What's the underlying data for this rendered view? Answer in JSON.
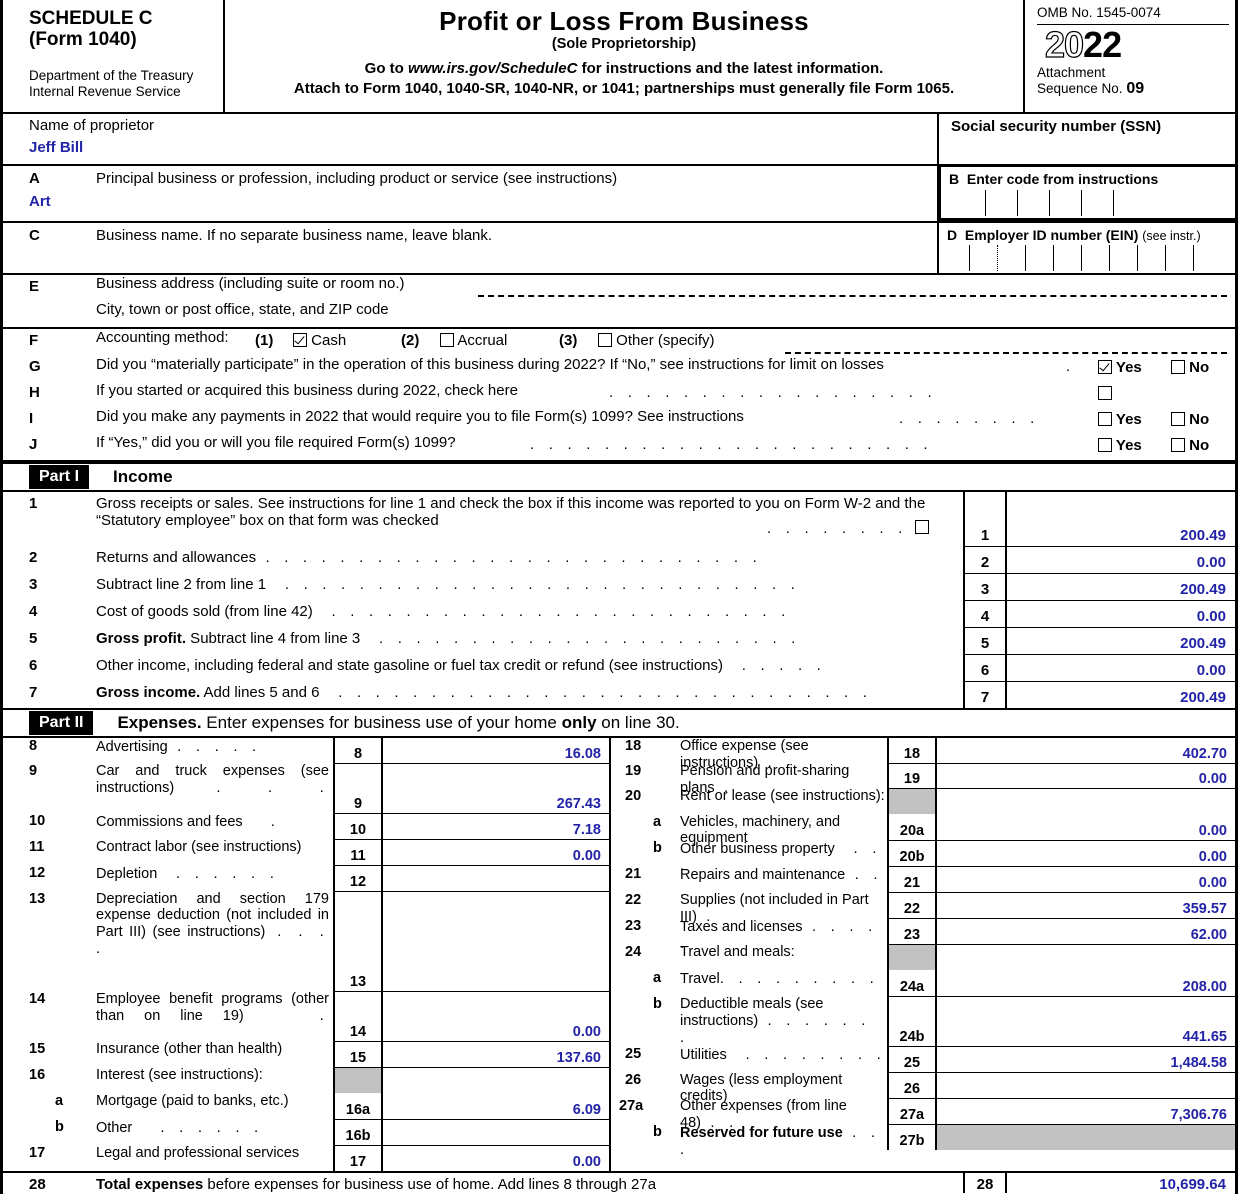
{
  "header": {
    "schedule": "SCHEDULE C",
    "form": "(Form 1040)",
    "dept_line1": "Department of the Treasury",
    "dept_line2": "Internal Revenue Service",
    "title": "Profit or Loss From Business",
    "subtitle": "(Sole Proprietorship)",
    "goto_prefix": "Go to ",
    "goto_url": "www.irs.gov/ScheduleC",
    "goto_suffix": " for instructions and the latest information.",
    "attach": "Attach to Form 1040, 1040-SR, 1040-NR, or 1041; partnerships must generally file Form 1065.",
    "omb": "OMB No. 1545-0074",
    "year_outline": "20",
    "year_solid": "22",
    "attachment_label": "Attachment",
    "sequence_label": "Sequence No. ",
    "sequence_no": "09"
  },
  "identity": {
    "name_label": "Name of proprietor",
    "name_value": "Jeff Bill",
    "ssn_label": "Social security number (SSN)",
    "ssn_value": "",
    "a_letter": "A",
    "a_label": "Principal business or profession, including product or service (see instructions)",
    "a_value": "Art",
    "b_letter": "B",
    "b_label": "Enter code from instructions",
    "b_value": "",
    "c_letter": "C",
    "c_label": "Business name. If no separate business name, leave blank.",
    "c_value": "",
    "d_letter": "D",
    "d_label": "Employer ID number (EIN)",
    "d_label_small": "(see instr.)",
    "d_value": ""
  },
  "questions": {
    "e_letter": "E",
    "e_label": "Business address (including suite or room no.)",
    "e_value": "",
    "e_city_label": "City, town or post office, state, and ZIP code",
    "e_city_value": "",
    "f_letter": "F",
    "f_label": "Accounting method:",
    "f_options": [
      {
        "num": "(1)",
        "label": "Cash",
        "checked": true
      },
      {
        "num": "(2)",
        "label": "Accrual",
        "checked": false
      },
      {
        "num": "(3)",
        "label": "Other (specify)",
        "checked": false
      }
    ],
    "g_letter": "G",
    "g_label": "Did you “materially participate” in the operation of this business during 2022? If “No,” see instructions for limit on losses",
    "g_yes": "Yes",
    "g_no": "No",
    "g_yes_checked": true,
    "g_no_checked": false,
    "h_letter": "H",
    "h_label": "If you started or acquired this business during 2022, check here",
    "h_checked": false,
    "i_letter": "I",
    "i_label": "Did you make any payments in 2022 that would require you to file Form(s) 1099? See instructions",
    "i_yes": "Yes",
    "i_no": "No",
    "i_yes_checked": false,
    "i_no_checked": false,
    "j_letter": "J",
    "j_label": "If “Yes,” did you or will you file required Form(s) 1099?",
    "j_yes": "Yes",
    "j_no": "No",
    "j_yes_checked": false,
    "j_no_checked": false
  },
  "part1": {
    "tag": "Part I",
    "title": "Income",
    "lines": [
      {
        "no": "1",
        "text_bold": "",
        "text": "Gross receipts or sales. See instructions for line 1 and check the box if this income was reported to you on Form W-2 and the “Statutory employee” box on that form was checked",
        "num": "1",
        "amount": "200.49",
        "has_checkbox": true,
        "checked": false
      },
      {
        "no": "2",
        "text_bold": "",
        "text": "Returns and allowances",
        "num": "2",
        "amount": "0.00"
      },
      {
        "no": "3",
        "text_bold": "",
        "text": "Subtract line 2 from line 1",
        "num": "3",
        "amount": "200.49"
      },
      {
        "no": "4",
        "text_bold": "",
        "text": "Cost of goods sold (from line 42)",
        "num": "4",
        "amount": "0.00"
      },
      {
        "no": "5",
        "text_bold": "Gross profit.",
        "text": " Subtract line 4 from line 3",
        "num": "5",
        "amount": "200.49"
      },
      {
        "no": "6",
        "text_bold": "",
        "text": "Other income, including federal and state gasoline or fuel tax credit or refund (see instructions)",
        "num": "6",
        "amount": "0.00"
      },
      {
        "no": "7",
        "text_bold": "Gross income.",
        "text": " Add lines 5 and 6",
        "num": "7",
        "amount": "200.49"
      }
    ]
  },
  "part2": {
    "tag": "Part II",
    "title_bold": "Expenses.",
    "title_rest": " Enter expenses for business use of your home ",
    "title_bold2": "only",
    "title_rest2": " on line 30.",
    "left": [
      {
        "no": "8",
        "text": "Advertising",
        "dots": ".  .   .   .   .",
        "num": "8",
        "amount": "16.08"
      },
      {
        "no": "9",
        "text": "Car and truck expenses (see instructions)",
        "dots": ".   .   .",
        "num": "9",
        "amount": "267.43"
      },
      {
        "no": "10",
        "text": "Commissions and fees",
        "dots": ".",
        "num": "10",
        "amount": "7.18"
      },
      {
        "no": "11",
        "text": "Contract labor (see instructions)",
        "dots": "",
        "num": "11",
        "amount": "0.00"
      },
      {
        "no": "12",
        "text": "Depletion",
        "dots": ".   .   .   .   .   .",
        "num": "12",
        "amount": ""
      },
      {
        "no": "13",
        "text": "Depreciation and section 179 expense deduction (not included in Part III) (see instructions)",
        "dots": ".   .   .   .",
        "num": "13",
        "amount": ""
      },
      {
        "no": "14",
        "text": "Employee benefit programs (other than on line 19)",
        "dots": ".",
        "num": "14",
        "amount": "0.00"
      },
      {
        "no": "15",
        "text": "Insurance (other than health)",
        "dots": "",
        "num": "15",
        "amount": "137.60"
      },
      {
        "no": "16",
        "text": "Interest (see instructions):",
        "dots": "",
        "num": "",
        "amount": "",
        "shaded": true
      },
      {
        "no": "a",
        "text": "Mortgage (paid to banks, etc.)",
        "dots": "",
        "num": "16a",
        "amount": "6.09"
      },
      {
        "no": "b",
        "text": "Other",
        "dots": ".   .   .   .   .   .",
        "num": "16b",
        "amount": ""
      },
      {
        "no": "17",
        "text": "Legal and professional services",
        "dots": "",
        "num": "17",
        "amount": "0.00"
      }
    ],
    "right": [
      {
        "no": "18",
        "text": "Office expense (see instructions)",
        "dots": ".",
        "num": "18",
        "amount": "402.70"
      },
      {
        "no": "19",
        "text": "Pension and profit-sharing plans",
        "dots": ".",
        "num": "19",
        "amount": "0.00"
      },
      {
        "no": "20",
        "text": "Rent or lease (see instructions):",
        "dots": "",
        "num": "",
        "amount": "",
        "shaded": true
      },
      {
        "no": "a",
        "text": "Vehicles, machinery, and equipment",
        "dots": "",
        "num": "20a",
        "amount": "0.00"
      },
      {
        "no": "b",
        "text": "Other business property",
        "dots": ".   .   .",
        "num": "20b",
        "amount": "0.00"
      },
      {
        "no": "21",
        "text": "Repairs and maintenance",
        "dots": ".   .   .",
        "num": "21",
        "amount": "0.00"
      },
      {
        "no": "22",
        "text": "Supplies (not included in Part III)",
        "dots": ".",
        "num": "22",
        "amount": "359.57"
      },
      {
        "no": "23",
        "text": "Taxes and licenses",
        "dots": ".   .   .   .   .",
        "num": "23",
        "amount": "62.00"
      },
      {
        "no": "24",
        "text": "Travel and meals:",
        "dots": "",
        "num": "",
        "amount": "",
        "shaded": true
      },
      {
        "no": "a",
        "text": "Travel",
        "dots": ".   .   .   .   .   .   .   .   .",
        "num": "24a",
        "amount": "208.00"
      },
      {
        "no": "b",
        "text": "Deductible meals (see instructions)",
        "dots": ".   .   .   .   .   .   .",
        "num": "24b",
        "amount": "441.65"
      },
      {
        "no": "25",
        "text": "Utilities",
        "dots": ".   .   .   .   .   .   .   .",
        "num": "25",
        "amount": "1,484.58"
      },
      {
        "no": "26",
        "text": "Wages (less employment credits)",
        "dots": "",
        "num": "26",
        "amount": ""
      },
      {
        "no": "27a",
        "text": "Other expenses (from line 48)",
        "dots": ".   .",
        "num": "27a",
        "amount": "7,306.76"
      },
      {
        "no": "b",
        "text": "Reserved for future use",
        "bold": true,
        "dots": ".   .   .",
        "num": "27b",
        "amount": "",
        "shaded_amount": true
      }
    ]
  },
  "line28": {
    "no": "28",
    "text_bold": "Total expenses",
    "text": " before expenses for business use of home. Add lines 8 through 27a",
    "num": "28",
    "amount": "10,699.64"
  },
  "colors": {
    "entry_blue": "#2323a8",
    "shade_gray": "#c2c2c2"
  }
}
